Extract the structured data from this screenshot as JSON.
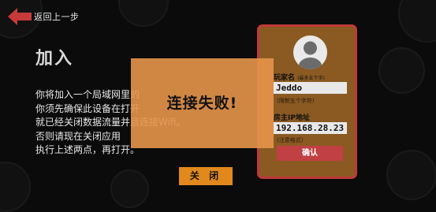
{
  "back_button": {
    "label": "返回上一步"
  },
  "page_title": "加入",
  "instructions": [
    "你将加入一个局域网里的",
    "你须先确保此设备在打开",
    "就已经关闭数据流量并且连接Wifi。",
    "否则请现在关闭应用",
    "执行上述两点，再打开。"
  ],
  "card": {
    "player_name_label": "玩家名",
    "player_name_note": "(最多五个字)",
    "player_name_value": "Jeddo",
    "player_name_hint": "(限制五个字符)",
    "host_ip_label": "房主IP地址",
    "host_ip_value": "192.168.28.23",
    "host_ip_hint": "(注意格式)",
    "confirm_label": "确认"
  },
  "dialog": {
    "message": "连接失败!",
    "close_label": "关 闭"
  },
  "colors": {
    "accent_red": "#c13a3a",
    "overlay_orange": "#e7954a",
    "card_brown": "#8a5a22",
    "close_orange": "#e1891d"
  },
  "icons": [
    "back-arrow-icon",
    "avatar-icon"
  ]
}
